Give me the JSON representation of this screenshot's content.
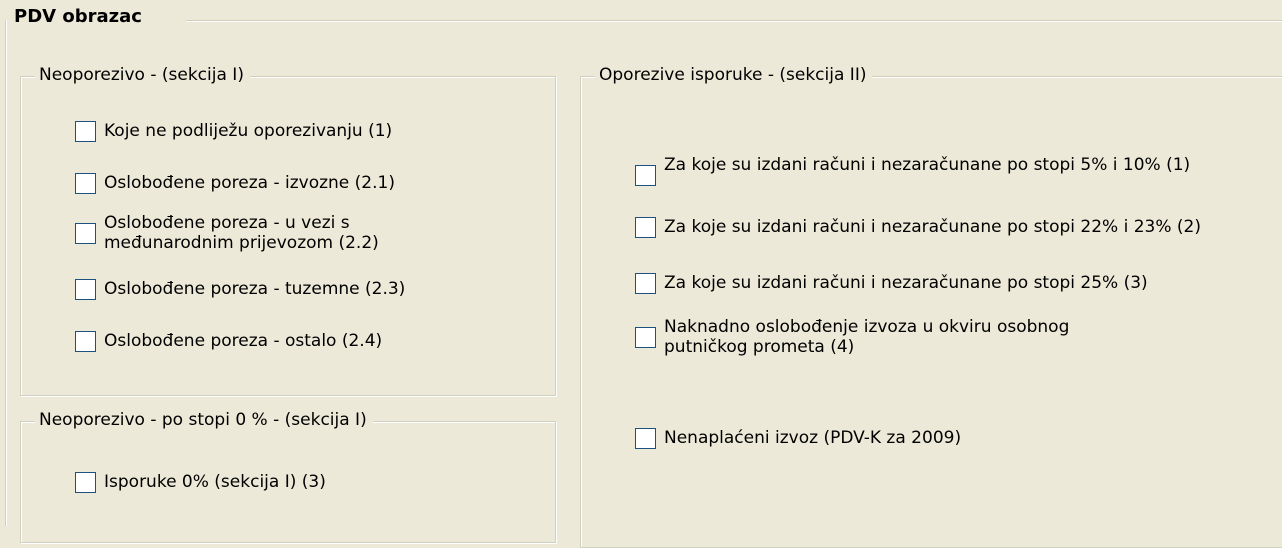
{
  "form": {
    "title": "PDV obrazac"
  },
  "sections": {
    "neoporezivo": {
      "legend": "Neoporezivo - (sekcija I)",
      "items": [
        {
          "label": "Koje ne podliježu oporezivanju (1)",
          "checked": false
        },
        {
          "label": "Oslobođene poreza - izvozne (2.1)",
          "checked": false
        },
        {
          "label": "Oslobođene poreza - u vezi s međunarodnim prijevozom (2.2)",
          "checked": false
        },
        {
          "label": "Oslobođene poreza - tuzemne (2.3)",
          "checked": false
        },
        {
          "label": "Oslobođene poreza - ostalo (2.4)",
          "checked": false
        }
      ]
    },
    "neoporezivo_nula": {
      "legend": "Neoporezivo - po stopi 0 % - (sekcija I)",
      "items": [
        {
          "label": "Isporuke 0% (sekcija I) (3)",
          "checked": false
        }
      ]
    },
    "oporezive": {
      "legend": "Oporezive isporuke - (sekcija II)",
      "items": [
        {
          "label": "Za koje su izdani računi i nezaračunane po stopi 5% i 10% (1)",
          "checked": false
        },
        {
          "label": "Za koje su izdani računi i nezaračunane po stopi 22% i 23% (2)",
          "checked": false
        },
        {
          "label": "Za koje su izdani računi i nezaračunane po stopi 25% (3)",
          "checked": false
        },
        {
          "label": "Naknadno oslobođenje izvoza u okviru osobnog putničkog prometa (4)",
          "checked": false
        },
        {
          "label": "Nenaplaćeni izvoz (PDV-K za 2009)",
          "checked": false
        }
      ]
    }
  }
}
